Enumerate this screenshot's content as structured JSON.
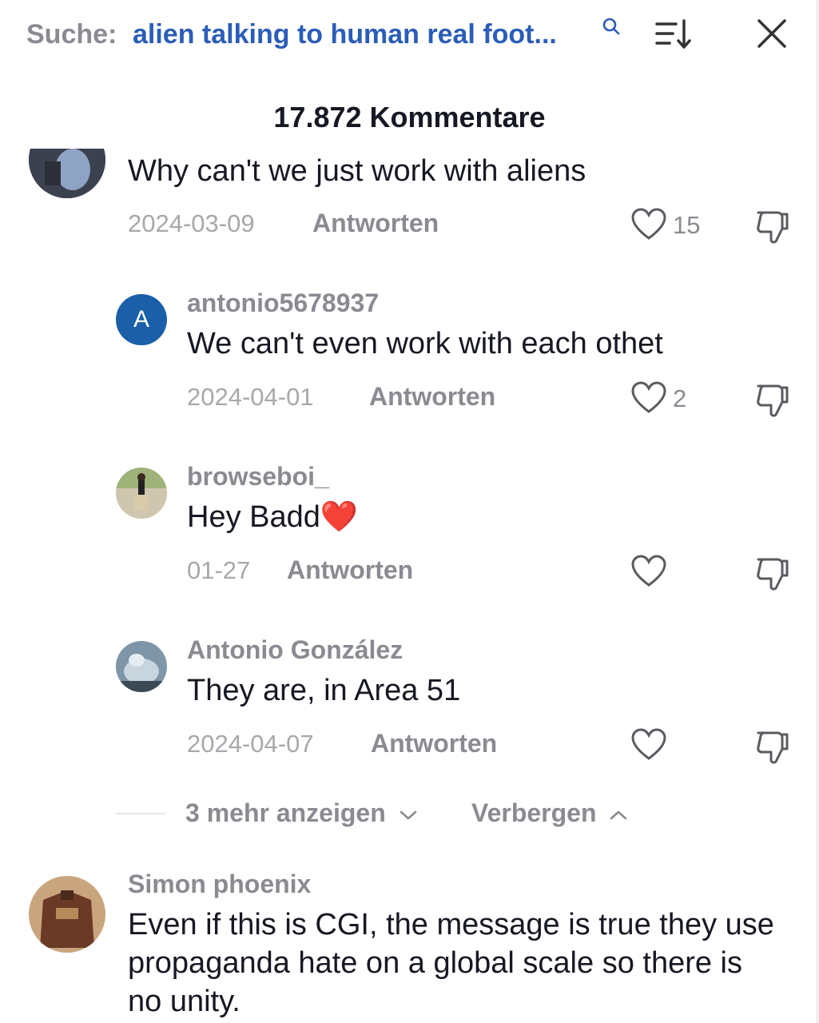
{
  "header": {
    "search_prefix": "Suche:",
    "search_query": "alien talking to human real foot...",
    "comment_count": "17.872 Kommentare"
  },
  "colors": {
    "query_blue": "#2b5db8",
    "muted_gray": "#8a8b91",
    "avatar_blue": "#1a5fa8"
  },
  "comments": [
    {
      "text": "Why can't we just work with aliens",
      "date": "2024-03-09",
      "reply_label": "Antworten",
      "likes": "15"
    },
    {
      "avatar_letter": "A",
      "username": "antonio5678937",
      "text": "We can't even work with each othet",
      "date": "2024-04-01",
      "reply_label": "Antworten",
      "likes": "2"
    },
    {
      "username": "browseboi_",
      "text": "Hey Badd❤️",
      "date": "01-27",
      "reply_label": "Antworten",
      "likes": ""
    },
    {
      "username": "Antonio González",
      "text": "They are, in Area 51",
      "date": "2024-04-07",
      "reply_label": "Antworten",
      "likes": ""
    },
    {
      "username": "Simon phoenix",
      "text": "Even if this is CGI, the message is true they use propaganda hate on a global scale so there is no unity."
    }
  ],
  "thread_controls": {
    "show_more": "3 mehr anzeigen",
    "hide": "Verbergen"
  },
  "icons": {
    "search": "search-icon",
    "sort": "sort-icon",
    "close": "close-icon",
    "like": "heart-icon",
    "dislike": "thumbs-down-icon"
  }
}
